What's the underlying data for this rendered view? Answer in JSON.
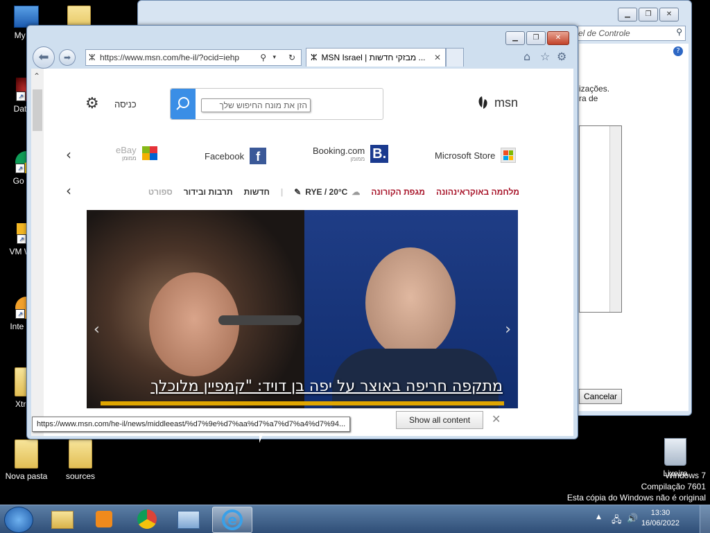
{
  "desktop": {
    "icons": [
      {
        "label": "My Co"
      },
      {
        "label": "DataW"
      },
      {
        "label": "Go Chr"
      },
      {
        "label": "VM Work"
      },
      {
        "label": "Inte Dow"
      },
      {
        "label": "Xtrem"
      },
      {
        "label": "Nova pasta"
      },
      {
        "label": "sources"
      },
      {
        "label": "Lixeira"
      }
    ]
  },
  "bg_window": {
    "address_text": "el de Controle",
    "text_line1": "izações.",
    "text_line2": "ra de",
    "cancel_button": "Cancelar"
  },
  "ie": {
    "address_url": "https://www.msn.com/he-il/?ocid=iehp",
    "tab_title": "MSN Israel | מבזקי חדשות ...",
    "status_url": "https://www.msn.com/he-il/news/middleeast/%d7%9e%d7%aa%d7%a7%d7%a4%d7%94..."
  },
  "msn": {
    "brand": "msn",
    "search_placeholder": "הזן את מונח החיפוש שלך",
    "signin": "כניסה",
    "shortcuts": [
      {
        "label": "Microsoft Store",
        "sub": ""
      },
      {
        "label": "Booking.com",
        "sub": "ממומן"
      },
      {
        "label": "Facebook",
        "sub": ""
      },
      {
        "label": "eBay",
        "sub": "ממומן"
      }
    ],
    "nav": {
      "war": "מלחמה באוקראינהונה",
      "corona": "מגפת הקורונה",
      "weather": "RYE / 20°C",
      "news": "חדשות",
      "culture": "תרבות ובידור",
      "sports": "ספורט"
    },
    "hero_title": "מתקפה חריפה באוצר על יפה בן דויד: \"קמפיין מלוכלך",
    "notification_button": "Show all content"
  },
  "taskbar": {
    "time": "13:30",
    "date": "16/06/2022"
  },
  "watermark": {
    "line1": "Windows 7",
    "line2": "Compilação 7601",
    "line3": "Esta cópia do Windows não é original"
  },
  "colors": {
    "accent_red": "#a8152a",
    "search_blue": "#3a8ee6",
    "booking_blue": "#1a3a8f",
    "facebook_blue": "#3b5998",
    "hero_bar": "#e0a600"
  }
}
